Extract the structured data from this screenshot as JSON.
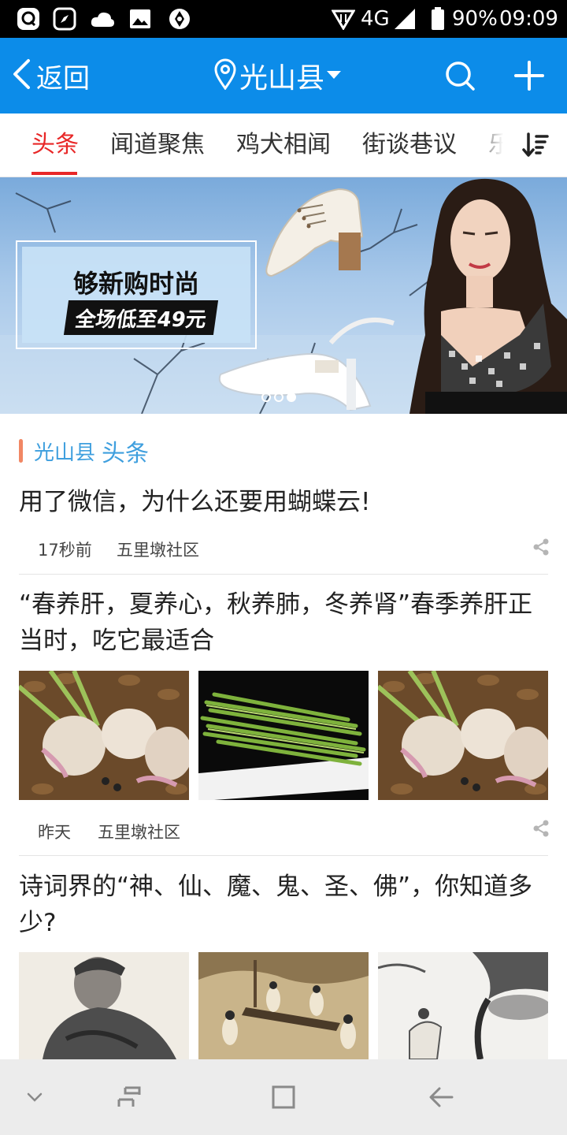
{
  "status_bar": {
    "network": "4G",
    "battery": "90%",
    "time": "09:09",
    "left_icons": [
      "qq-icon",
      "compass-icon",
      "cloud-icon",
      "image-icon",
      "aperture-icon"
    ]
  },
  "header": {
    "back_label": "返回",
    "location": "光山县",
    "background": "#0c8ce9"
  },
  "tabs": {
    "items": [
      "头条",
      "闻道聚焦",
      "鸡犬相闻",
      "街谈巷议",
      "乐"
    ],
    "active_index": 0,
    "accent": "#e82727"
  },
  "banner": {
    "title": "够新购时尚",
    "subtitle": "全场低至49元",
    "slide_count": 3,
    "active_slide": 3
  },
  "section": {
    "location": "光山县",
    "heading": "头条"
  },
  "articles": [
    {
      "title": "用了微信，为什么还要用蝴蝶云!",
      "time": "17秒前",
      "source": "五里墩社区"
    },
    {
      "title": "“春养肝，夏养心，秋养肺，冬养肾”春季养肝正当时，吃它最适合",
      "time": "昨天",
      "source": "五里墩社区"
    },
    {
      "title": "诗词界的“神、仙、魔、鬼、圣、佛”，你知道多少?"
    }
  ],
  "navbar": {
    "icons": [
      "chevron-down-icon",
      "recent-apps-icon",
      "home-icon",
      "back-icon"
    ]
  }
}
